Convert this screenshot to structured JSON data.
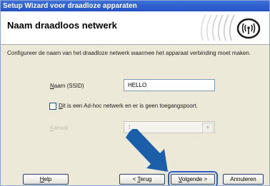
{
  "window": {
    "title": "Setup Wizard voor draadloze apparaten"
  },
  "banner": {
    "title": "Naam draadloos netwerk",
    "logo_icon": "wireless-signal-icon"
  },
  "description": "Configureer de naam van het draadloze netwerk waarmee het apparaat verbinding moet maken.",
  "form": {
    "ssid": {
      "label_accel": "N",
      "label_rest": "aam (SSID)",
      "value": "HELLO"
    },
    "adhoc": {
      "label_accel": "D",
      "label_rest": "it is een Ad-hoc netwerk en er is geen toegangspoort.",
      "checked": false
    },
    "channel": {
      "label_accel": "K",
      "label_rest": "anaal",
      "value": "1",
      "disabled": true
    }
  },
  "buttons": {
    "help": {
      "accel": "H",
      "rest": "elp"
    },
    "back": {
      "pre": "< ",
      "accel": "T",
      "rest": "erug"
    },
    "next": {
      "accel": "V",
      "rest": "olgende >"
    },
    "cancel": {
      "label": "Annuleren"
    }
  },
  "colors": {
    "title_bar": "#2a5ecf",
    "dialog_bg": "#ece9d8",
    "pointer_arrow": "#1c5fa8"
  },
  "pointer_icon": "blue-arrow-icon"
}
